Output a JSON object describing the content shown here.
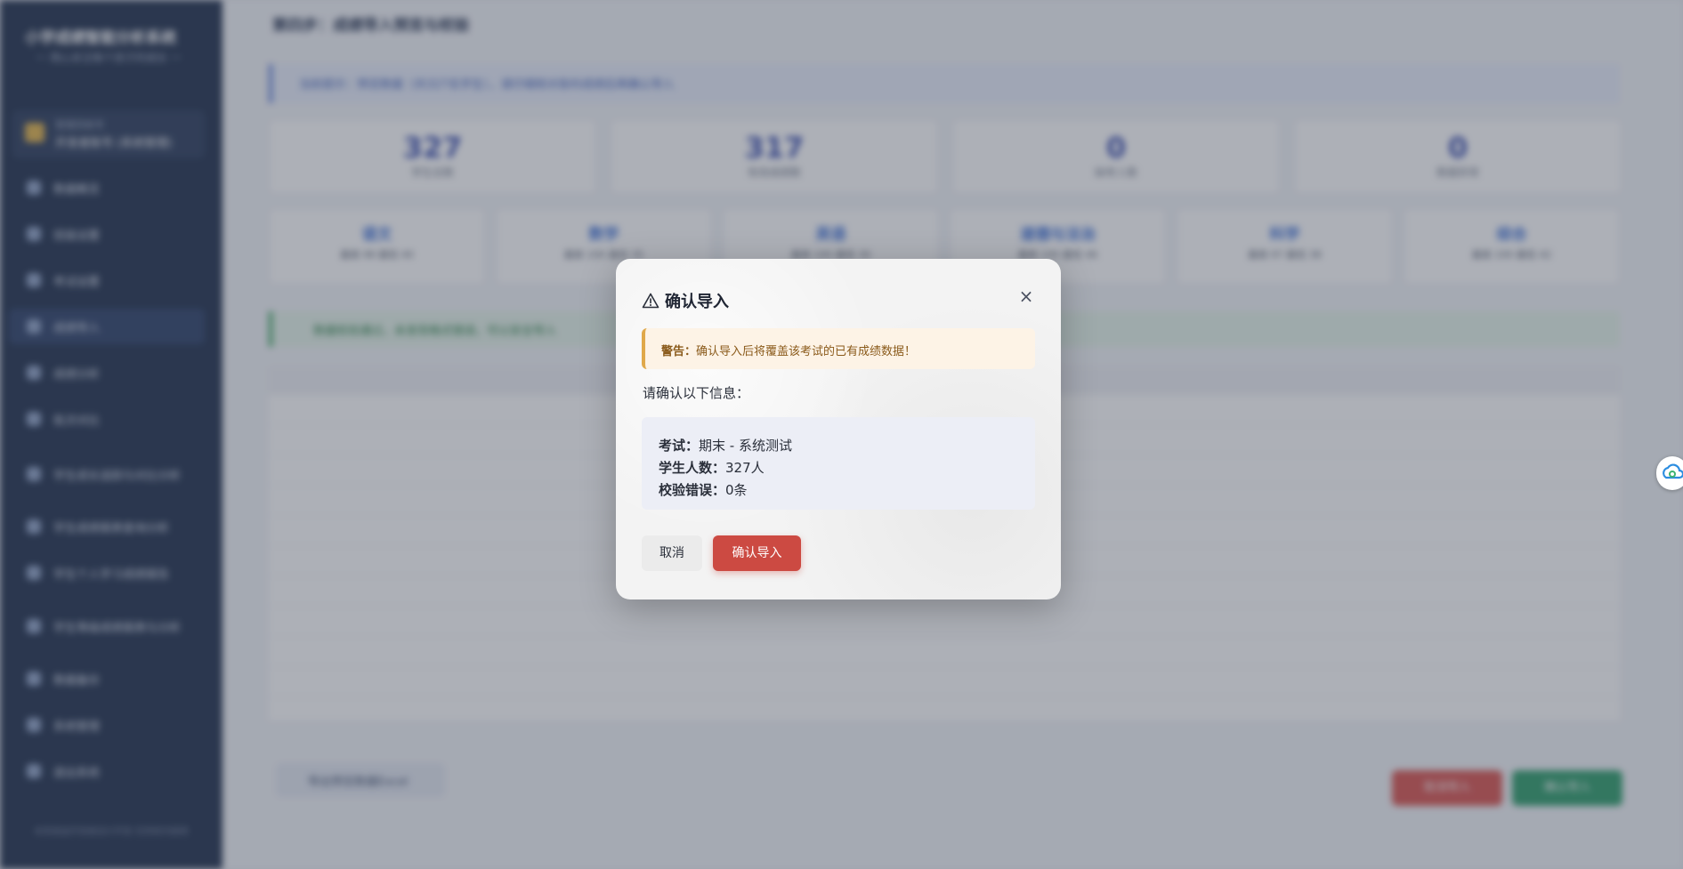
{
  "background": {
    "sidebar": {
      "title": "小学成绩智能分析系统",
      "subtitle": "一 用心关注每个孩子的成长 一",
      "user_role": "管理员账号",
      "user_name": "开发者账号 (系统管理)",
      "items": [
        {
          "label": "数据概览"
        },
        {
          "label": "班级设置"
        },
        {
          "label": "考试设置"
        },
        {
          "label": "成绩导入"
        },
        {
          "label": "成绩分析"
        },
        {
          "label": "批次对比"
        },
        {
          "label": "学生成长追踪与对比分析"
        },
        {
          "label": "学生成绩报表查询分析"
        },
        {
          "label": "学生个人学习成绩报告"
        },
        {
          "label": "学生等级成绩报表与分析"
        },
        {
          "label": "数据备份"
        },
        {
          "label": "系统管理"
        },
        {
          "label": "退出系统"
        }
      ],
      "footer": "本系统由开发者设计开发 仅供校内使用"
    },
    "main": {
      "breadcrumb": "第四步：成绩导入预览与校验",
      "tip": "当前提示：预览数据（共327名学生），请仔细核对各科成绩后再确认导入",
      "stats": [
        {
          "value": "327",
          "label": "学生总数"
        },
        {
          "value": "317",
          "label": "有效成绩数"
        },
        {
          "value": "0",
          "label": "缺考人数"
        },
        {
          "value": "0",
          "label": "数据异常"
        }
      ],
      "subjects": [
        {
          "name": "语文",
          "detail": "最高 98 最低 40"
        },
        {
          "name": "数学",
          "detail": "最高 100 最低 35"
        },
        {
          "name": "英语",
          "detail": "最高 100 最低 30"
        },
        {
          "name": "道德与法治",
          "detail": "最高 100 最低 46"
        },
        {
          "name": "科学",
          "detail": "最高 97 最低 38"
        },
        {
          "name": "综合",
          "detail": "最高 100 最低 42"
        }
      ],
      "ok_text": "数据校验通过，未发现格式错误，可以安全导入",
      "export_button": "导出预览数据Excel",
      "cancel_import_button": "取消导入",
      "confirm_import_button": "确认导入"
    }
  },
  "modal": {
    "title": "确认导入",
    "close_label": "×",
    "alert_label": "警告：",
    "alert_text": "确认导入后将覆盖该考试的已有成绩数据！",
    "ask_text": "请确认以下信息：",
    "info": [
      {
        "label": "考试：",
        "value": "期末 - 系统测试"
      },
      {
        "label": "学生人数：",
        "value": "327人"
      },
      {
        "label": "校验错误：",
        "value": "0条"
      }
    ],
    "cancel_button": "取消",
    "confirm_button": "确认导入"
  },
  "colors": {
    "sidebar_bg": "#1f2f4c",
    "confirm_red": "#cc4a42",
    "warning_bg": "#fdf3e6",
    "warning_border": "#e0a84a"
  },
  "icons": [
    "warning-triangle-icon",
    "close-icon",
    "cloud-assistant-icon"
  ]
}
